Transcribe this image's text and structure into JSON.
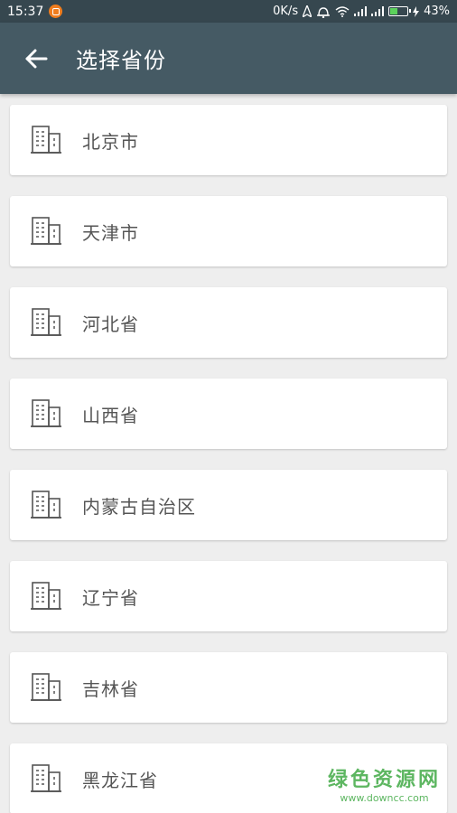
{
  "status_bar": {
    "time": "15:37",
    "net_speed": "0K/s",
    "battery_percent": "43%"
  },
  "toolbar": {
    "title": "选择省份"
  },
  "provinces": [
    {
      "label": "北京市"
    },
    {
      "label": "天津市"
    },
    {
      "label": "河北省"
    },
    {
      "label": "山西省"
    },
    {
      "label": "内蒙古自治区"
    },
    {
      "label": "辽宁省"
    },
    {
      "label": "吉林省"
    },
    {
      "label": "黑龙江省"
    }
  ],
  "watermark": {
    "main": "绿色资源网",
    "sub": "www.downcc.com"
  },
  "colors": {
    "status_bar": "#36474f",
    "toolbar": "#455a64",
    "background": "#eeeeee",
    "card": "#ffffff",
    "watermark": "#4caf50"
  }
}
